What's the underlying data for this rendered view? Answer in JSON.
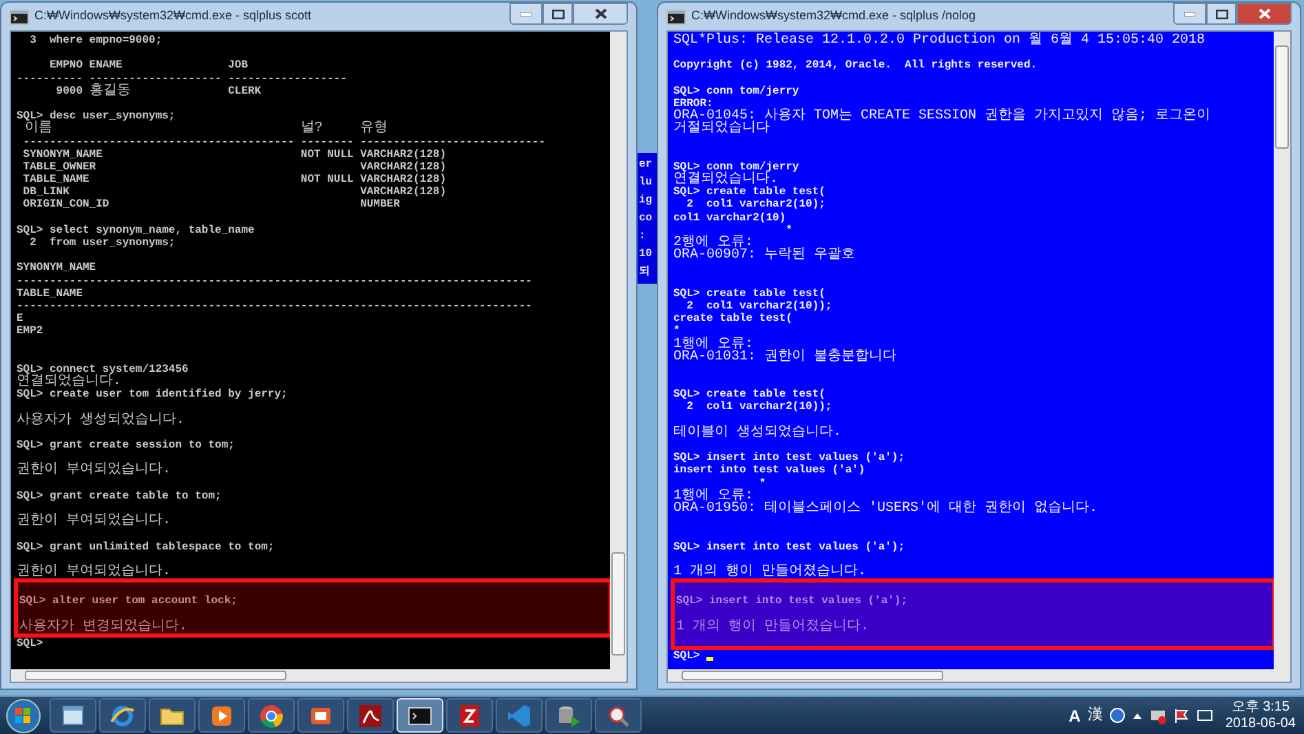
{
  "windows": [
    {
      "title": "C:₩Windows₩system32₩cmd.exe - sqlplus  scott",
      "kind": "dark",
      "active": false,
      "lines": [
        {
          "kind": "command",
          "text": "  3  where empno=9000;"
        },
        {
          "kind": "blank"
        },
        {
          "kind": "table",
          "rows": [
            [
              "     EMPNO",
              "ENAME",
              "JOB"
            ],
            [
              "----------",
              "--------------------",
              "------------------"
            ],
            [
              "      9000",
              {
                "kind": "message",
                "text": "홍길동"
              },
              "CLERK"
            ]
          ]
        },
        {
          "kind": "blank"
        },
        {
          "kind": "command",
          "text": "SQL> desc user_synonyms;"
        },
        {
          "kind": "table",
          "rows": [
            [
              {
                "kind": "message",
                "text": " 이름"
              },
              {
                "kind": "message",
                "text": "널?"
              },
              {
                "kind": "message",
                "text": "유형"
              }
            ],
            [
              " -----------------------------------------",
              "--------",
              "----------------------------"
            ],
            [
              " SYNONYM_NAME",
              "NOT NULL",
              "VARCHAR2(128)"
            ],
            [
              " TABLE_OWNER",
              null,
              "VARCHAR2(128)"
            ],
            [
              " TABLE_NAME",
              "NOT NULL",
              "VARCHAR2(128)"
            ],
            [
              " DB_LINK",
              null,
              "VARCHAR2(128)"
            ],
            [
              " ORIGIN_CON_ID",
              null,
              "NUMBER"
            ]
          ]
        },
        {
          "kind": "blank"
        },
        {
          "kind": "command",
          "text": "SQL> select synonym_name, table_name"
        },
        {
          "kind": "command",
          "text": "  2  from user_synonyms;"
        },
        {
          "kind": "blank"
        },
        {
          "kind": "command",
          "text": "SYNONYM_NAME"
        },
        {
          "kind": "command",
          "text": "------------------------------------------------------------------------------"
        },
        {
          "kind": "command",
          "text": "TABLE_NAME"
        },
        {
          "kind": "command",
          "text": "------------------------------------------------------------------------------"
        },
        {
          "kind": "command",
          "text": "E"
        },
        {
          "kind": "command",
          "text": "EMP2"
        },
        {
          "kind": "blank"
        },
        {
          "kind": "blank"
        },
        {
          "kind": "command",
          "text": "SQL> connect system/123456"
        },
        {
          "kind": "message",
          "text": "연결되었습니다."
        },
        {
          "kind": "command",
          "text": "SQL> create user tom identified by jerry;"
        },
        {
          "kind": "blank"
        },
        {
          "kind": "message",
          "text": "사용자가 생성되었습니다."
        },
        {
          "kind": "blank"
        },
        {
          "kind": "command",
          "text": "SQL> grant create session to tom;"
        },
        {
          "kind": "blank"
        },
        {
          "kind": "message",
          "text": "권한이 부여되었습니다."
        },
        {
          "kind": "blank"
        },
        {
          "kind": "command",
          "text": "SQL> grant create table to tom;"
        },
        {
          "kind": "blank"
        },
        {
          "kind": "message",
          "text": "권한이 부여되었습니다."
        },
        {
          "kind": "blank"
        },
        {
          "kind": "command",
          "text": "SQL> grant unlimited tablespace to tom;"
        },
        {
          "kind": "blank"
        },
        {
          "kind": "message",
          "text": "권한이 부여되었습니다."
        }
      ],
      "highlight": {
        "lines": [
          {
            "kind": "blank"
          },
          {
            "kind": "command",
            "text": "SQL> alter user tom account lock;"
          },
          {
            "kind": "blank"
          },
          {
            "kind": "message",
            "text": "사용자가 변경되었습니다."
          }
        ]
      },
      "lines_after": [
        {
          "kind": "prompt",
          "text": "SQL>",
          "cursor": false
        }
      ]
    },
    {
      "title": "C:₩Windows₩system32₩cmd.exe - sqlplus  /nolog",
      "kind": "blue",
      "active": true,
      "lines": [
        {
          "kind": "message",
          "text": "SQL*Plus: Release 12.1.0.2.0 Production on 월 6월 4 15:05:40 2018"
        },
        {
          "kind": "blank"
        },
        {
          "kind": "command",
          "text": "Copyright (c) 1982, 2014, Oracle.  All rights reserved."
        },
        {
          "kind": "blank"
        },
        {
          "kind": "command",
          "text": "SQL> conn tom/jerry"
        },
        {
          "kind": "command",
          "text": "ERROR:"
        },
        {
          "kind": "message",
          "text": "ORA-01045: 사용자 TOM는 CREATE SESSION 권한을 가지고있지 않음; 로그온이"
        },
        {
          "kind": "message",
          "text": "거절되었습니다"
        },
        {
          "kind": "blank"
        },
        {
          "kind": "blank"
        },
        {
          "kind": "command",
          "text": "SQL> conn tom/jerry"
        },
        {
          "kind": "message",
          "text": "연결되었습니다."
        },
        {
          "kind": "command",
          "text": "SQL> create table test("
        },
        {
          "kind": "command",
          "text": "  2  col1 varchar2(10);"
        },
        {
          "kind": "command",
          "text": "col1 varchar2(10)"
        },
        {
          "kind": "command",
          "text": "                 *"
        },
        {
          "kind": "message",
          "text": "2행에 오류:"
        },
        {
          "kind": "message",
          "text": "ORA-00907: 누락된 우괄호"
        },
        {
          "kind": "blank"
        },
        {
          "kind": "blank"
        },
        {
          "kind": "command",
          "text": "SQL> create table test("
        },
        {
          "kind": "command",
          "text": "  2  col1 varchar2(10));"
        },
        {
          "kind": "command",
          "text": "create table test("
        },
        {
          "kind": "command",
          "text": "*"
        },
        {
          "kind": "message",
          "text": "1행에 오류:"
        },
        {
          "kind": "message",
          "text": "ORA-01031: 권한이 불충분합니다"
        },
        {
          "kind": "blank"
        },
        {
          "kind": "blank"
        },
        {
          "kind": "command",
          "text": "SQL> create table test("
        },
        {
          "kind": "command",
          "text": "  2  col1 varchar2(10));"
        },
        {
          "kind": "blank"
        },
        {
          "kind": "message",
          "text": "테이블이 생성되었습니다."
        },
        {
          "kind": "blank"
        },
        {
          "kind": "command",
          "text": "SQL> insert into test values ('a');"
        },
        {
          "kind": "command",
          "text": "insert into test values ('a')"
        },
        {
          "kind": "command",
          "text": "             *"
        },
        {
          "kind": "message",
          "text": "1행에 오류:"
        },
        {
          "kind": "message",
          "text": "ORA-01950: 테이블스페이스 'USERS'에 대한 권한이 없습니다."
        },
        {
          "kind": "blank"
        },
        {
          "kind": "blank"
        },
        {
          "kind": "command",
          "text": "SQL> insert into test values ('a');"
        },
        {
          "kind": "blank"
        },
        {
          "kind": "message",
          "text": "1 개의 행이 만들어졌습니다."
        }
      ],
      "highlight": {
        "lines": [
          {
            "kind": "blank"
          },
          {
            "kind": "command",
            "text": "SQL> insert into test values ('a');"
          },
          {
            "kind": "blank"
          },
          {
            "kind": "message",
            "text": "1 개의 행이 만들어졌습니다."
          },
          {
            "kind": "blank"
          }
        ]
      },
      "lines_after": [
        {
          "kind": "prompt",
          "text": "SQL>",
          "cursor": true
        }
      ]
    }
  ],
  "background_window": {
    "fragments": [
      "er",
      "lu",
      "ig",
      "co",
      ":",
      "10",
      "되"
    ]
  },
  "taskbar": {
    "apps": [
      {
        "kind": "window",
        "active": false
      },
      {
        "kind": "ie",
        "active": false
      },
      {
        "kind": "folder",
        "active": false
      },
      {
        "kind": "media",
        "active": false
      },
      {
        "kind": "chrome",
        "active": false
      },
      {
        "kind": "ec",
        "active": false
      },
      {
        "kind": "pdf",
        "active": false
      },
      {
        "kind": "cmd",
        "active": true
      },
      {
        "kind": "filezilla",
        "active": false
      },
      {
        "kind": "vscode",
        "active": false
      },
      {
        "kind": "database",
        "active": false
      },
      {
        "kind": "tool",
        "active": false
      }
    ],
    "ime": "A",
    "hanja": "漢",
    "time": "오후 3:15",
    "date": "2018-06-04"
  }
}
